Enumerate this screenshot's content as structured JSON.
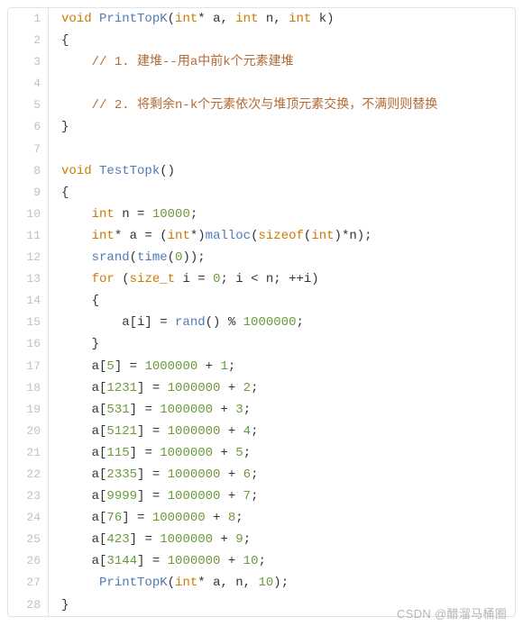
{
  "watermark": "CSDN @醋溜马桶圈",
  "lines": [
    {
      "n": "1",
      "seg": [
        {
          "c": "kw",
          "t": "void"
        },
        {
          "t": " "
        },
        {
          "c": "fn",
          "t": "PrintTopK"
        },
        {
          "t": "("
        },
        {
          "c": "kw",
          "t": "int"
        },
        {
          "t": "* a, "
        },
        {
          "c": "kw",
          "t": "int"
        },
        {
          "t": " n, "
        },
        {
          "c": "kw",
          "t": "int"
        },
        {
          "t": " k)"
        }
      ]
    },
    {
      "n": "2",
      "seg": [
        {
          "t": "{"
        }
      ]
    },
    {
      "n": "3",
      "seg": [
        {
          "t": "    "
        },
        {
          "c": "cm",
          "t": "// 1. 建堆--用a中前k个元素建堆"
        }
      ]
    },
    {
      "n": "4",
      "seg": [
        {
          "t": ""
        }
      ]
    },
    {
      "n": "5",
      "seg": [
        {
          "t": "    "
        },
        {
          "c": "cm",
          "t": "// 2. 将剩余n-k个元素依次与堆顶元素交换，不满则则替换"
        }
      ]
    },
    {
      "n": "6",
      "seg": [
        {
          "t": "}"
        }
      ]
    },
    {
      "n": "7",
      "seg": [
        {
          "t": ""
        }
      ]
    },
    {
      "n": "8",
      "seg": [
        {
          "c": "kw",
          "t": "void"
        },
        {
          "t": " "
        },
        {
          "c": "fn",
          "t": "TestTopk"
        },
        {
          "t": "()"
        }
      ]
    },
    {
      "n": "9",
      "seg": [
        {
          "t": "{"
        }
      ]
    },
    {
      "n": "10",
      "seg": [
        {
          "t": "    "
        },
        {
          "c": "kw",
          "t": "int"
        },
        {
          "t": " n = "
        },
        {
          "c": "nm",
          "t": "10000"
        },
        {
          "t": ";"
        }
      ]
    },
    {
      "n": "11",
      "seg": [
        {
          "t": "    "
        },
        {
          "c": "kw",
          "t": "int"
        },
        {
          "t": "* a = ("
        },
        {
          "c": "kw",
          "t": "int"
        },
        {
          "t": "*)"
        },
        {
          "c": "fn",
          "t": "malloc"
        },
        {
          "t": "("
        },
        {
          "c": "kw",
          "t": "sizeof"
        },
        {
          "t": "("
        },
        {
          "c": "kw",
          "t": "int"
        },
        {
          "t": ")*n);"
        }
      ]
    },
    {
      "n": "12",
      "seg": [
        {
          "t": "    "
        },
        {
          "c": "fn",
          "t": "srand"
        },
        {
          "t": "("
        },
        {
          "c": "fn",
          "t": "time"
        },
        {
          "t": "("
        },
        {
          "c": "nm",
          "t": "0"
        },
        {
          "t": "));"
        }
      ]
    },
    {
      "n": "13",
      "seg": [
        {
          "t": "    "
        },
        {
          "c": "kw",
          "t": "for"
        },
        {
          "t": " ("
        },
        {
          "c": "kw",
          "t": "size_t"
        },
        {
          "t": " i = "
        },
        {
          "c": "nm",
          "t": "0"
        },
        {
          "t": "; i < n; ++i)"
        }
      ]
    },
    {
      "n": "14",
      "seg": [
        {
          "t": "    {"
        }
      ]
    },
    {
      "n": "15",
      "seg": [
        {
          "t": "        a[i] = "
        },
        {
          "c": "fn",
          "t": "rand"
        },
        {
          "t": "() % "
        },
        {
          "c": "nm",
          "t": "1000000"
        },
        {
          "t": ";"
        }
      ]
    },
    {
      "n": "16",
      "seg": [
        {
          "t": "    }"
        }
      ]
    },
    {
      "n": "17",
      "seg": [
        {
          "t": "    a["
        },
        {
          "c": "nm",
          "t": "5"
        },
        {
          "t": "] = "
        },
        {
          "c": "nm",
          "t": "1000000"
        },
        {
          "t": " + "
        },
        {
          "c": "nm",
          "t": "1"
        },
        {
          "t": ";"
        }
      ]
    },
    {
      "n": "18",
      "seg": [
        {
          "t": "    a["
        },
        {
          "c": "nm",
          "t": "1231"
        },
        {
          "t": "] = "
        },
        {
          "c": "nm",
          "t": "1000000"
        },
        {
          "t": " + "
        },
        {
          "c": "nm",
          "t": "2"
        },
        {
          "t": ";"
        }
      ]
    },
    {
      "n": "19",
      "seg": [
        {
          "t": "    a["
        },
        {
          "c": "nm",
          "t": "531"
        },
        {
          "t": "] = "
        },
        {
          "c": "nm",
          "t": "1000000"
        },
        {
          "t": " + "
        },
        {
          "c": "nm",
          "t": "3"
        },
        {
          "t": ";"
        }
      ]
    },
    {
      "n": "20",
      "seg": [
        {
          "t": "    a["
        },
        {
          "c": "nm",
          "t": "5121"
        },
        {
          "t": "] = "
        },
        {
          "c": "nm",
          "t": "1000000"
        },
        {
          "t": " + "
        },
        {
          "c": "nm",
          "t": "4"
        },
        {
          "t": ";"
        }
      ]
    },
    {
      "n": "21",
      "seg": [
        {
          "t": "    a["
        },
        {
          "c": "nm",
          "t": "115"
        },
        {
          "t": "] = "
        },
        {
          "c": "nm",
          "t": "1000000"
        },
        {
          "t": " + "
        },
        {
          "c": "nm",
          "t": "5"
        },
        {
          "t": ";"
        }
      ]
    },
    {
      "n": "22",
      "seg": [
        {
          "t": "    a["
        },
        {
          "c": "nm",
          "t": "2335"
        },
        {
          "t": "] = "
        },
        {
          "c": "nm",
          "t": "1000000"
        },
        {
          "t": " + "
        },
        {
          "c": "nm",
          "t": "6"
        },
        {
          "t": ";"
        }
      ]
    },
    {
      "n": "23",
      "seg": [
        {
          "t": "    a["
        },
        {
          "c": "nm",
          "t": "9999"
        },
        {
          "t": "] = "
        },
        {
          "c": "nm",
          "t": "1000000"
        },
        {
          "t": " + "
        },
        {
          "c": "nm",
          "t": "7"
        },
        {
          "t": ";"
        }
      ]
    },
    {
      "n": "24",
      "seg": [
        {
          "t": "    a["
        },
        {
          "c": "nm",
          "t": "76"
        },
        {
          "t": "] = "
        },
        {
          "c": "nm",
          "t": "1000000"
        },
        {
          "t": " + "
        },
        {
          "c": "nm",
          "t": "8"
        },
        {
          "t": ";"
        }
      ]
    },
    {
      "n": "25",
      "seg": [
        {
          "t": "    a["
        },
        {
          "c": "nm",
          "t": "423"
        },
        {
          "t": "] = "
        },
        {
          "c": "nm",
          "t": "1000000"
        },
        {
          "t": " + "
        },
        {
          "c": "nm",
          "t": "9"
        },
        {
          "t": ";"
        }
      ]
    },
    {
      "n": "26",
      "seg": [
        {
          "t": "    a["
        },
        {
          "c": "nm",
          "t": "3144"
        },
        {
          "t": "] = "
        },
        {
          "c": "nm",
          "t": "1000000"
        },
        {
          "t": " + "
        },
        {
          "c": "nm",
          "t": "10"
        },
        {
          "t": ";"
        }
      ]
    },
    {
      "n": "27",
      "seg": [
        {
          "t": "     "
        },
        {
          "c": "fn",
          "t": "PrintTopK"
        },
        {
          "t": "("
        },
        {
          "c": "kw",
          "t": "int"
        },
        {
          "t": "* a, n, "
        },
        {
          "c": "nm",
          "t": "10"
        },
        {
          "t": ");"
        }
      ]
    },
    {
      "n": "28",
      "seg": [
        {
          "t": "}"
        }
      ]
    }
  ]
}
